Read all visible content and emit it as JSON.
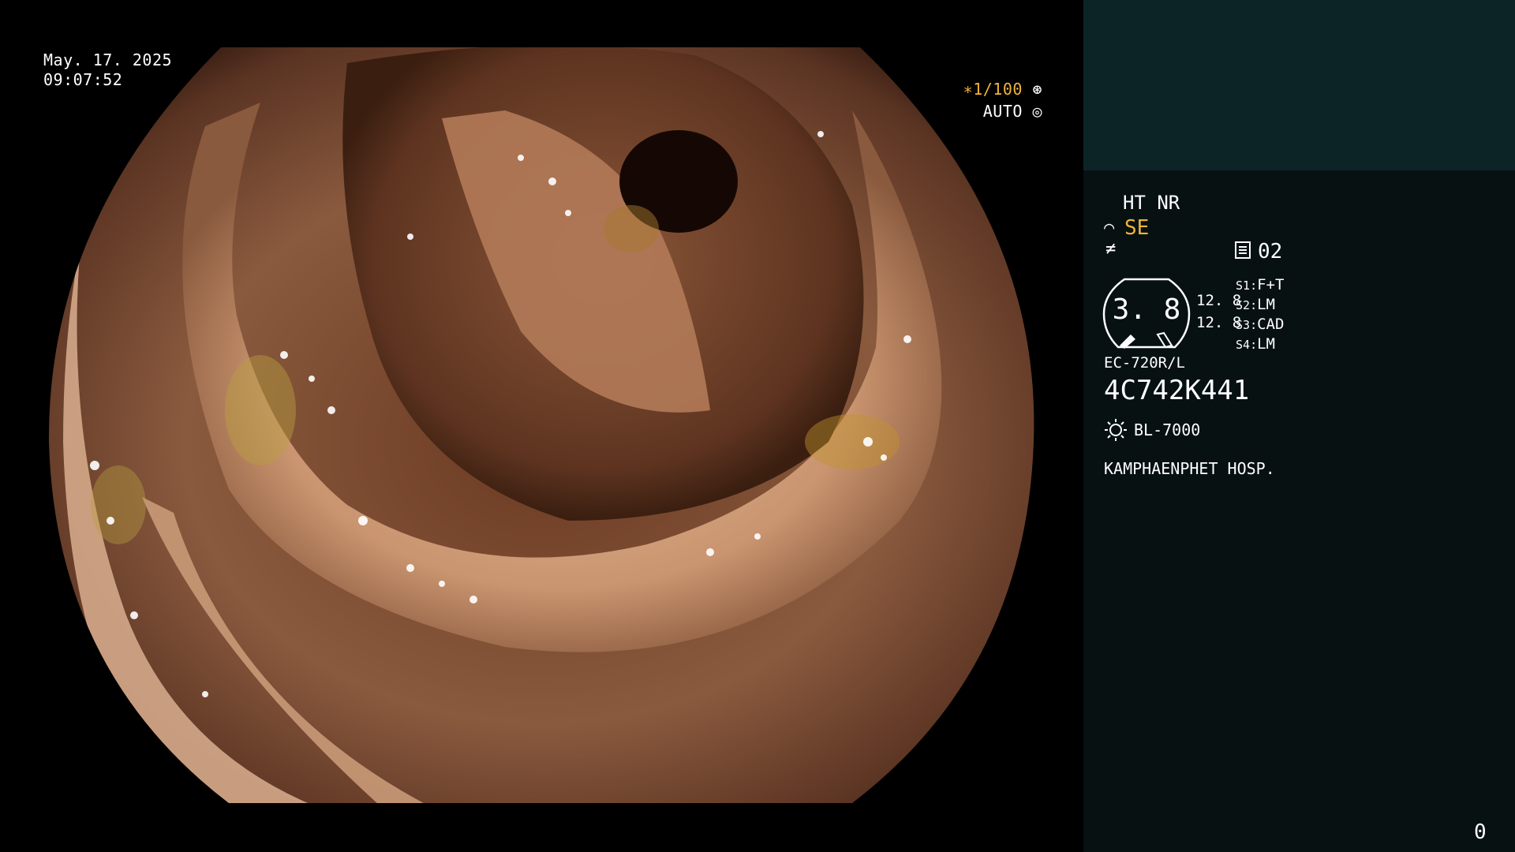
{
  "overlay": {
    "date": "May. 17. 2025",
    "time": "09:07:52",
    "shutter": "∗1/100",
    "exposure": "AUTO"
  },
  "panel": {
    "modes": "HT NR",
    "structure_enhance": "SE",
    "memory_label": "02",
    "dial_value": "3. 8",
    "values": [
      "12. 8",
      "12. 8"
    ],
    "switches": [
      {
        "key": "S1",
        "value": "F+T"
      },
      {
        "key": "S2",
        "value": "LM"
      },
      {
        "key": "S3",
        "value": "CAD"
      },
      {
        "key": "S4",
        "value": "LM"
      }
    ],
    "scope_model": "EC-720R/L",
    "scope_serial": "4C742K441",
    "light_source": "BL-7000",
    "hospital": "KAMPHAENPHET HOSP.",
    "counter": "0"
  },
  "icons": [
    "shutter-icon",
    "auto-iris-icon",
    "scope-se-icon",
    "freeze-icon",
    "memory-icon",
    "light-source-icon"
  ],
  "colors": {
    "accent": "#f0b43a",
    "panel_bg": "#071112",
    "panel_top": "#0c2426"
  }
}
